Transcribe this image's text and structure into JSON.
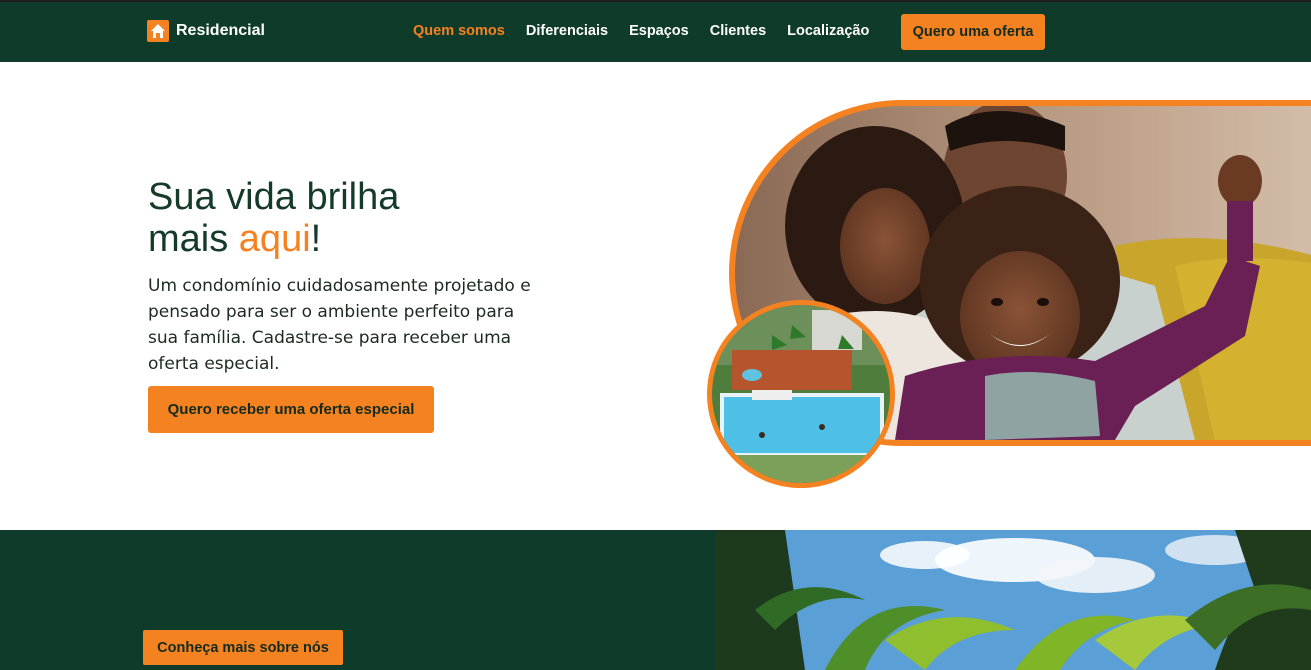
{
  "header": {
    "logo_text": "Residencial",
    "logo_icon": "house-icon",
    "nav": [
      {
        "label": "Quem somos",
        "active": true
      },
      {
        "label": "Diferenciais",
        "active": false
      },
      {
        "label": "Espaços",
        "active": false
      },
      {
        "label": "Clientes",
        "active": false
      },
      {
        "label": "Localização",
        "active": false
      }
    ],
    "cta_label": "Quero uma oferta"
  },
  "hero": {
    "title_line1": "Sua vida brilha",
    "title_line2_before": "mais ",
    "title_line2_accent": "aqui",
    "title_line2_after": "!",
    "description": "Um condomínio cuidadosamente projetado e pensado para ser o ambiente perfeito para sua família. Cadastre-se para receber uma oferta especial.",
    "cta_label": "Quero receber uma oferta especial"
  },
  "section2": {
    "cta_label": "Conheça mais sobre nós"
  },
  "colors": {
    "brand_dark": "#0f3b2a",
    "accent": "#f58220",
    "white": "#ffffff"
  }
}
